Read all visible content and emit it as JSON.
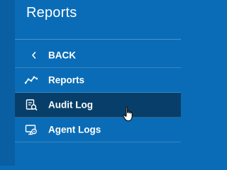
{
  "header": {
    "title": "Reports"
  },
  "menu": {
    "back_label": "BACK",
    "items": [
      {
        "label": "Reports",
        "icon": "line-chart-icon"
      },
      {
        "label": "Audit Log",
        "icon": "audit-log-icon",
        "active": true
      },
      {
        "label": "Agent Logs",
        "icon": "agent-logs-icon"
      }
    ]
  },
  "colors": {
    "panel_bg": "#0a6cb6",
    "rail_bg": "#0a5fa3",
    "active_bg": "#073f6a",
    "text": "#ffffff"
  }
}
